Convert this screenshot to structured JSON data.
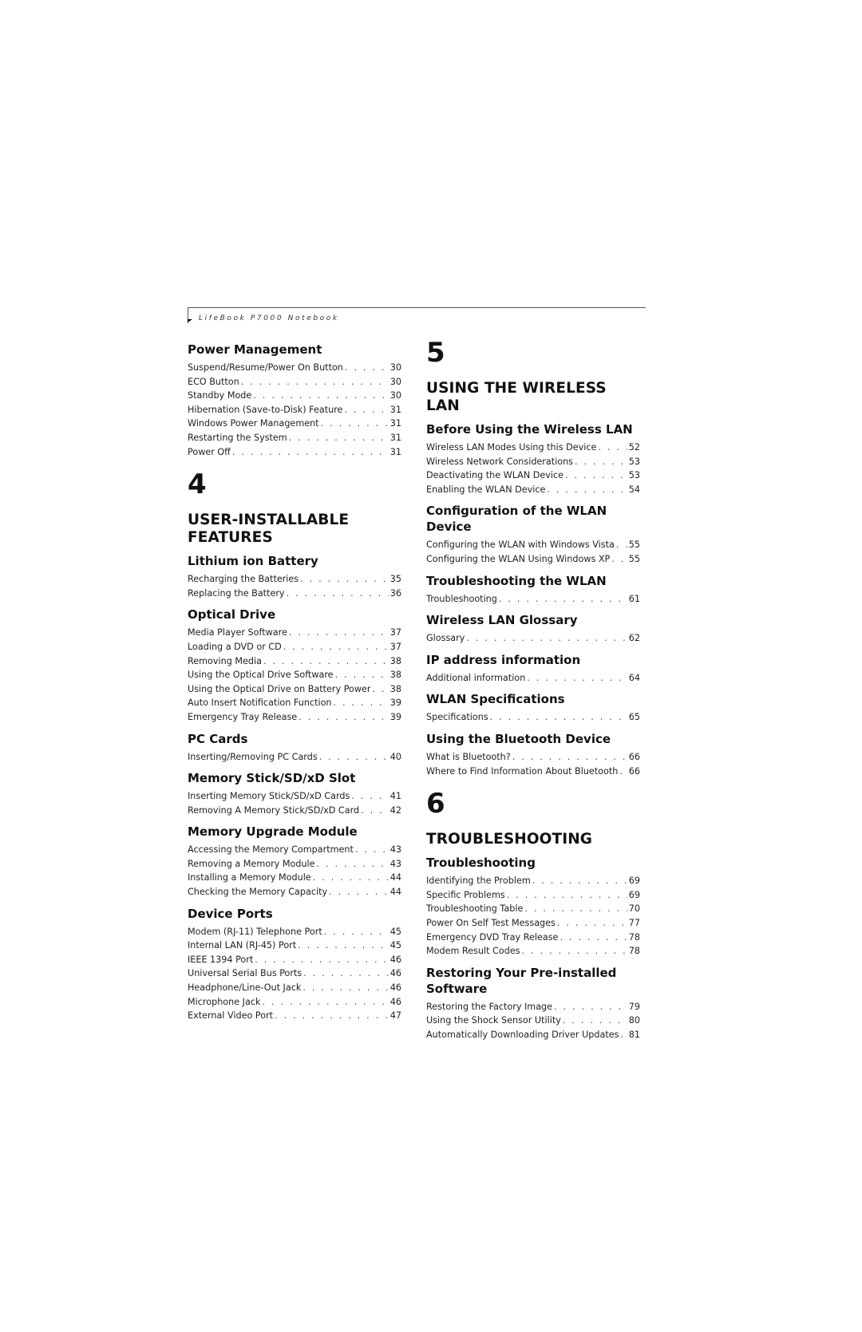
{
  "header": {
    "title": "LifeBook P7000 Notebook"
  },
  "left_column": [
    {
      "type": "section",
      "title": "Power Management",
      "entries": [
        {
          "label": "Suspend/Resume/Power On Button",
          "page": "30"
        },
        {
          "label": "ECO Button",
          "page": "30"
        },
        {
          "label": "Standby Mode",
          "page": "30"
        },
        {
          "label": "Hibernation (Save-to-Disk) Feature",
          "page": "31"
        },
        {
          "label": "Windows Power Management",
          "page": "31"
        },
        {
          "label": "Restarting the System",
          "page": "31"
        },
        {
          "label": "Power Off",
          "page": "31"
        }
      ]
    },
    {
      "type": "chapter",
      "number": "4",
      "title": "USER-INSTALLABLE FEATURES"
    },
    {
      "type": "section",
      "title": "Lithium ion Battery",
      "entries": [
        {
          "label": "Recharging the Batteries",
          "page": "35"
        },
        {
          "label": "Replacing the Battery",
          "page": "36"
        }
      ]
    },
    {
      "type": "section",
      "title": "Optical Drive",
      "entries": [
        {
          "label": "Media Player Software",
          "page": "37"
        },
        {
          "label": "Loading a DVD or CD",
          "page": "37"
        },
        {
          "label": "Removing Media",
          "page": "38"
        },
        {
          "label": "Using the Optical Drive Software",
          "page": "38"
        },
        {
          "label": "Using the Optical Drive on Battery Power",
          "page": "38"
        },
        {
          "label": "Auto Insert Notification Function",
          "page": "39"
        },
        {
          "label": "Emergency Tray Release",
          "page": "39"
        }
      ]
    },
    {
      "type": "section",
      "title": "PC Cards",
      "entries": [
        {
          "label": "Inserting/Removing PC Cards",
          "page": "40"
        }
      ]
    },
    {
      "type": "section",
      "title": "Memory Stick/SD/xD Slot",
      "entries": [
        {
          "label": "Inserting Memory Stick/SD/xD Cards",
          "page": "41"
        },
        {
          "label": "Removing A Memory Stick/SD/xD Card",
          "page": "42"
        }
      ]
    },
    {
      "type": "section",
      "title": "Memory Upgrade Module",
      "entries": [
        {
          "label": "Accessing the Memory Compartment",
          "page": "43"
        },
        {
          "label": "Removing a Memory Module",
          "page": "43"
        },
        {
          "label": "Installing a Memory Module",
          "page": "44"
        },
        {
          "label": "Checking the Memory Capacity",
          "page": "44"
        }
      ]
    },
    {
      "type": "section",
      "title": "Device Ports",
      "entries": [
        {
          "label": "Modem (RJ-11) Telephone Port",
          "page": "45"
        },
        {
          "label": "Internal LAN (RJ-45) Port",
          "page": "45"
        },
        {
          "label": "IEEE 1394 Port",
          "page": "46"
        },
        {
          "label": "Universal Serial Bus Ports",
          "page": "46"
        },
        {
          "label": "Headphone/Line-Out Jack",
          "page": "46"
        },
        {
          "label": "Microphone Jack",
          "page": "46"
        },
        {
          "label": "External Video Port",
          "page": "47"
        }
      ]
    }
  ],
  "right_column": [
    {
      "type": "chapter",
      "number": "5",
      "title": "USING THE WIRELESS LAN"
    },
    {
      "type": "section",
      "title": "Before Using the Wireless LAN",
      "entries": [
        {
          "label": "Wireless LAN Modes Using this Device",
          "page": "52"
        },
        {
          "label": "Wireless Network Considerations",
          "page": "53"
        },
        {
          "label": "Deactivating the WLAN Device",
          "page": "53"
        },
        {
          "label": "Enabling the WLAN Device",
          "page": "54"
        }
      ]
    },
    {
      "type": "section",
      "title": "Configuration of the WLAN Device",
      "entries": [
        {
          "label": "Configuring the WLAN with Windows Vista",
          "page": "55"
        },
        {
          "label": "Configuring the WLAN Using Windows XP",
          "page": "55"
        }
      ]
    },
    {
      "type": "section",
      "title": "Troubleshooting the WLAN",
      "entries": [
        {
          "label": "Troubleshooting",
          "page": "61"
        }
      ]
    },
    {
      "type": "section",
      "title": "Wireless LAN Glossary",
      "entries": [
        {
          "label": "Glossary",
          "page": "62"
        }
      ]
    },
    {
      "type": "section",
      "title": "IP address information",
      "entries": [
        {
          "label": "Additional information",
          "page": "64"
        }
      ]
    },
    {
      "type": "section",
      "title": "WLAN Specifications",
      "entries": [
        {
          "label": "Specifications",
          "page": "65"
        }
      ]
    },
    {
      "type": "section",
      "title": "Using the Bluetooth Device",
      "entries": [
        {
          "label": "What is Bluetooth?",
          "page": "66"
        },
        {
          "label": "Where to Find Information About Bluetooth",
          "page": "66"
        }
      ]
    },
    {
      "type": "chapter",
      "number": "6",
      "title": "TROUBLESHOOTING"
    },
    {
      "type": "section",
      "title": "Troubleshooting",
      "entries": [
        {
          "label": "Identifying the Problem",
          "page": "69"
        },
        {
          "label": "Specific Problems",
          "page": "69"
        },
        {
          "label": "Troubleshooting Table",
          "page": "70"
        },
        {
          "label": "Power On Self Test Messages",
          "page": "77"
        },
        {
          "label": "Emergency DVD Tray Release",
          "page": "78"
        },
        {
          "label": "Modem Result Codes",
          "page": "78"
        }
      ]
    },
    {
      "type": "section",
      "title": "Restoring Your Pre-installed Software",
      "entries": [
        {
          "label": "Restoring the Factory Image",
          "page": "79"
        },
        {
          "label": "Using the Shock Sensor Utility",
          "page": "80"
        },
        {
          "label": "Automatically Downloading Driver Updates",
          "page": "81"
        }
      ]
    }
  ]
}
